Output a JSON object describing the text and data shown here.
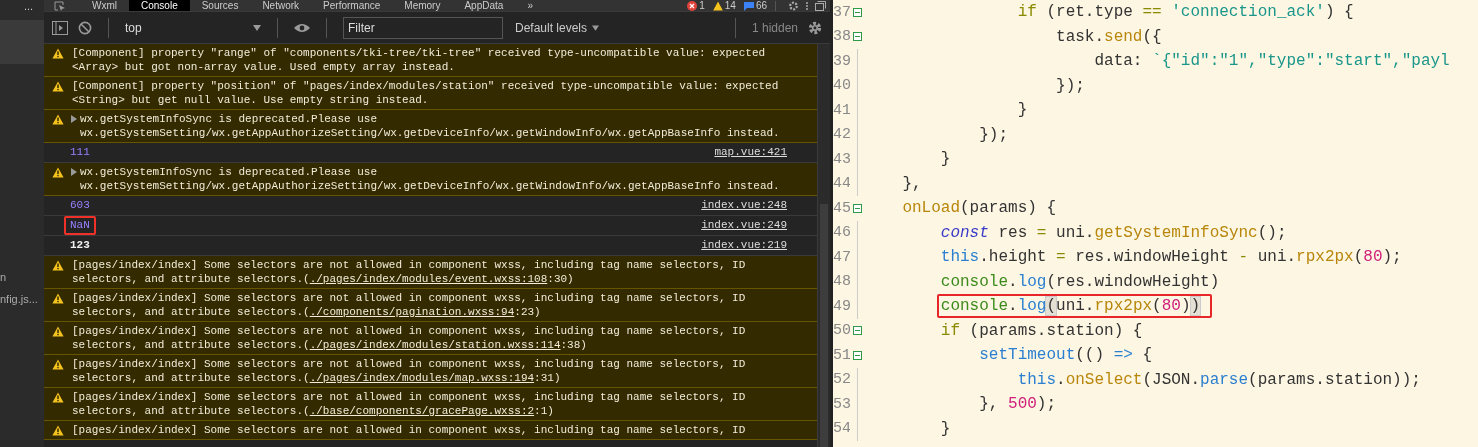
{
  "sidebar": {
    "menu": "...",
    "items": [
      {
        "label": "n"
      },
      {
        "label": "nfig.js..."
      }
    ]
  },
  "devtools": {
    "tabs": [
      {
        "label": "Wxml",
        "selected": false
      },
      {
        "label": "Console",
        "selected": true
      },
      {
        "label": "Sources",
        "selected": false
      },
      {
        "label": "Network",
        "selected": false
      },
      {
        "label": "Performance",
        "selected": false
      },
      {
        "label": "Memory",
        "selected": false
      },
      {
        "label": "AppData",
        "selected": false
      }
    ],
    "more_tabs": "»",
    "errors": "1",
    "warnings": "14",
    "infos": "66",
    "toolbar": {
      "context": "top",
      "filter_placeholder": "Filter",
      "levels": "Default levels",
      "hidden": "1 hidden"
    },
    "messages": [
      {
        "kind": "warning",
        "text": "[Component] property \"range\" of \"components/tki-tree/tki-tree\" received type-uncompatible value: expected <Array> but got non-array value. Used empty array instead."
      },
      {
        "kind": "warning",
        "text": "[Component] property \"position\" of \"pages/index/modules/station\" received type-uncompatible value: expected <String> but get null value. Use empty string instead."
      },
      {
        "kind": "warning",
        "expanded": false,
        "text": "wx.getSystemInfoSync is deprecated.Please use wx.getSystemSetting/wx.getAppAuthorizeSetting/wx.getDeviceInfo/wx.getWindowInfo/wx.getAppBaseInfo instead."
      },
      {
        "kind": "number",
        "text": "111",
        "source": "map.vue:421"
      },
      {
        "kind": "warning",
        "expanded": false,
        "text": "wx.getSystemInfoSync is deprecated.Please use wx.getSystemSetting/wx.getAppAuthorizeSetting/wx.getDeviceInfo/wx.getWindowInfo/wx.getAppBaseInfo instead."
      },
      {
        "kind": "number",
        "text": "603",
        "source": "index.vue:248"
      },
      {
        "kind": "number",
        "highlighted": true,
        "text": "NaN",
        "source": "index.vue:249"
      },
      {
        "kind": "string",
        "text": "123",
        "source": "index.vue:219"
      },
      {
        "kind": "warning",
        "text": "[pages/index/index] Some selectors are not allowed in component wxss, including tag name selectors, ID selectors, and attribute selectors.(",
        "link": "./pages/index/modules/event.wxss:108",
        "after": ":30)"
      },
      {
        "kind": "warning",
        "text": "[pages/index/index] Some selectors are not allowed in component wxss, including tag name selectors, ID selectors, and attribute selectors.(",
        "link": "./components/pagination.wxss:94",
        "after": ":23)"
      },
      {
        "kind": "warning",
        "text": "[pages/index/index] Some selectors are not allowed in component wxss, including tag name selectors, ID selectors, and attribute selectors.(",
        "link": "./pages/index/modules/station.wxss:114",
        "after": ":38)"
      },
      {
        "kind": "warning",
        "text": "[pages/index/index] Some selectors are not allowed in component wxss, including tag name selectors, ID selectors, and attribute selectors.(",
        "link": "./pages/index/modules/map.wxss:194",
        "after": ":31)"
      },
      {
        "kind": "warning",
        "text": "[pages/index/index] Some selectors are not allowed in component wxss, including tag name selectors, ID selectors, and attribute selectors.(",
        "link": "./base/components/gracePage.wxss:2",
        "after": ":1)"
      },
      {
        "kind": "warning",
        "text": "[pages/index/index] Some selectors are not allowed in component wxss, including tag name selectors, ID"
      }
    ]
  },
  "editor": {
    "lines": [
      {
        "number": "37",
        "fold": true,
        "highlighted": false,
        "tokens": [
          {
            "kind": "keyword",
            "text": "                if"
          },
          {
            "kind": "plain",
            "text": " (ret.type "
          },
          {
            "kind": "keyword",
            "text": "=="
          },
          {
            "kind": "string",
            "text": " 'connection_ack'"
          },
          {
            "kind": "plain",
            "text": ") {"
          }
        ]
      },
      {
        "number": "38",
        "fold": true,
        "highlighted": false,
        "tokens": [
          {
            "kind": "plain",
            "text": "                    task."
          },
          {
            "kind": "method",
            "text": "send"
          },
          {
            "kind": "plain",
            "text": "({"
          }
        ]
      },
      {
        "number": "39",
        "fold": false,
        "highlighted": false,
        "tokens": [
          {
            "kind": "plain",
            "text": "                        data: "
          },
          {
            "kind": "string",
            "text": "`{\"id\":\"1\",\"type\":\"start\",\"payl"
          }
        ]
      },
      {
        "number": "40",
        "fold": false,
        "highlighted": false,
        "tokens": [
          {
            "kind": "plain",
            "text": "                    });"
          }
        ]
      },
      {
        "number": "41",
        "fold": false,
        "highlighted": false,
        "tokens": [
          {
            "kind": "plain",
            "text": "                }"
          }
        ]
      },
      {
        "number": "42",
        "fold": false,
        "highlighted": false,
        "tokens": [
          {
            "kind": "plain",
            "text": "            });"
          }
        ]
      },
      {
        "number": "43",
        "fold": false,
        "highlighted": false,
        "tokens": [
          {
            "kind": "plain",
            "text": "        }"
          }
        ]
      },
      {
        "number": "44",
        "fold": false,
        "highlighted": false,
        "tokens": [
          {
            "kind": "plain",
            "text": "    },"
          }
        ]
      },
      {
        "number": "45",
        "fold": true,
        "highlighted": false,
        "tokens": [
          {
            "kind": "method",
            "text": "    onLoad"
          },
          {
            "kind": "plain",
            "text": "(params) {"
          }
        ]
      },
      {
        "number": "46",
        "fold": false,
        "highlighted": false,
        "tokens": [
          {
            "kind": "storage",
            "text": "        const"
          },
          {
            "kind": "plain",
            "text": " res "
          },
          {
            "kind": "keyword",
            "text": "="
          },
          {
            "kind": "plain",
            "text": " uni."
          },
          {
            "kind": "method",
            "text": "getSystemInfoSync"
          },
          {
            "kind": "plain",
            "text": "();"
          }
        ]
      },
      {
        "number": "47",
        "fold": false,
        "highlighted": false,
        "tokens": [
          {
            "kind": "builtin",
            "text": "        this"
          },
          {
            "kind": "plain",
            "text": ".height "
          },
          {
            "kind": "keyword",
            "text": "="
          },
          {
            "kind": "plain",
            "text": " res.windowHeight "
          },
          {
            "kind": "keyword",
            "text": "-"
          },
          {
            "kind": "plain",
            "text": " uni."
          },
          {
            "kind": "method",
            "text": "rpx2px"
          },
          {
            "kind": "plain",
            "text": "("
          },
          {
            "kind": "number",
            "text": "80"
          },
          {
            "kind": "plain",
            "text": ");"
          }
        ]
      },
      {
        "number": "48",
        "fold": false,
        "highlighted": false,
        "tokens": [
          {
            "kind": "console",
            "text": "        console"
          },
          {
            "kind": "plain",
            "text": "."
          },
          {
            "kind": "builtin",
            "text": "log"
          },
          {
            "kind": "plain",
            "text": "(res.windowHeight)"
          }
        ]
      },
      {
        "number": "49",
        "fold": false,
        "highlighted": true,
        "tokens": [
          {
            "kind": "console",
            "text": "        console"
          },
          {
            "kind": "plain",
            "text": "."
          },
          {
            "kind": "builtin",
            "text": "log"
          },
          {
            "kind": "match",
            "text": "("
          },
          {
            "kind": "plain",
            "text": "uni."
          },
          {
            "kind": "method",
            "text": "rpx2px"
          },
          {
            "kind": "plain",
            "text": "("
          },
          {
            "kind": "number",
            "text": "80"
          },
          {
            "kind": "plain",
            "text": ")"
          },
          {
            "kind": "match",
            "text": ")"
          }
        ]
      },
      {
        "number": "50",
        "fold": true,
        "highlighted": false,
        "tokens": [
          {
            "kind": "keyword",
            "text": "        if"
          },
          {
            "kind": "plain",
            "text": " (params.station) {"
          }
        ]
      },
      {
        "number": "51",
        "fold": true,
        "highlighted": false,
        "tokens": [
          {
            "kind": "builtin",
            "text": "            setTimeout"
          },
          {
            "kind": "plain",
            "text": "(() "
          },
          {
            "kind": "builtin",
            "text": "=>"
          },
          {
            "kind": "plain",
            "text": " {"
          }
        ]
      },
      {
        "number": "52",
        "fold": false,
        "highlighted": false,
        "tokens": [
          {
            "kind": "builtin",
            "text": "                this"
          },
          {
            "kind": "plain",
            "text": "."
          },
          {
            "kind": "method",
            "text": "onSelect"
          },
          {
            "kind": "plain",
            "text": "(JSON."
          },
          {
            "kind": "builtin",
            "text": "parse"
          },
          {
            "kind": "plain",
            "text": "(params.station));"
          }
        ]
      },
      {
        "number": "53",
        "fold": false,
        "highlighted": false,
        "tokens": [
          {
            "kind": "plain",
            "text": "            }, "
          },
          {
            "kind": "number",
            "text": "500"
          },
          {
            "kind": "plain",
            "text": ");"
          }
        ]
      },
      {
        "number": "54",
        "fold": false,
        "highlighted": false,
        "tokens": [
          {
            "kind": "plain",
            "text": "        }"
          }
        ]
      }
    ]
  }
}
